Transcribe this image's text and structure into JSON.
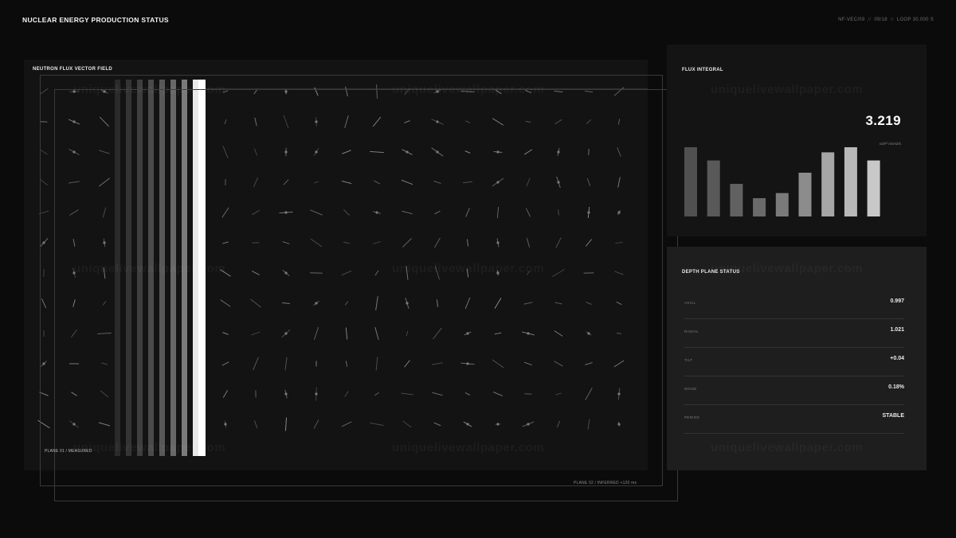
{
  "header": {
    "title": "NUCLEAR ENERGY PRODUCTION STATUS",
    "meta": [
      "NF-VEC/09",
      "09/18",
      "LOOP 30.000 S"
    ],
    "separator": "//"
  },
  "vector_field": {
    "title": "NEUTRON FLUX VECTOR FIELD",
    "plane_measured": "PLANE 01 / MEASURED",
    "plane_inferred": "PLANE 02 / INFERRED +120 ms"
  },
  "flux_integral": {
    "title": "FLUX INTEGRAL",
    "value": "3.219",
    "unit": "x10¹³ n/cm2/s",
    "bar_values": [
      0.68,
      0.55,
      0.32,
      0.18,
      0.23,
      0.43,
      0.63,
      0.68,
      0.55
    ],
    "bar_colors": [
      "#505050",
      "#595959",
      "#616161",
      "#6a6a6a",
      "#7a7a7a",
      "#8c8c8c",
      "#a6a6a6",
      "#b8b8b8",
      "#c8c8c8"
    ]
  },
  "depth_plane": {
    "title": "DEPTH PLANE STATUS",
    "rows": [
      {
        "label": "AXIAL",
        "value": "0.997"
      },
      {
        "label": "RADIAL",
        "value": "1.021"
      },
      {
        "label": "TILT",
        "value": "+0.04"
      },
      {
        "label": "NOISE",
        "value": "0.18%"
      },
      {
        "label": "PERIOD",
        "value": "STABLE"
      }
    ]
  },
  "watermark": "uniquelivewallpaper.com",
  "colors": {
    "background": "#0a0b0a",
    "panel": "#131313",
    "accent": "#ffffff"
  }
}
